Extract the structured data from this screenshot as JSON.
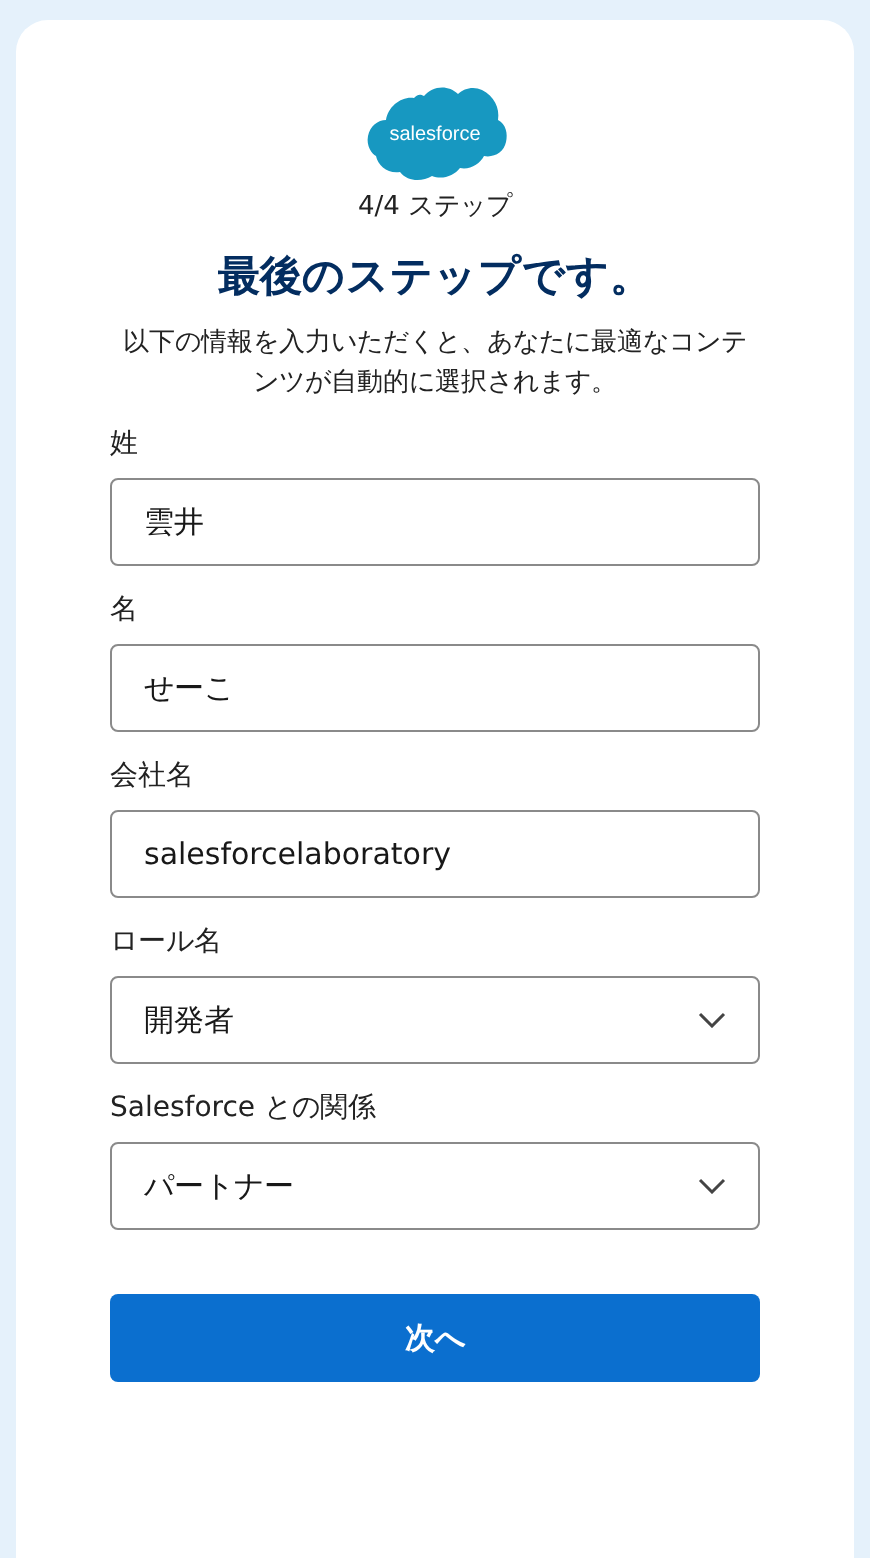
{
  "logo": {
    "text": "salesforce"
  },
  "step": "4/4 ステップ",
  "title": "最後のステップです。",
  "description": "以下の情報を入力いただくと、あなたに最適なコンテンツが自動的に選択されます。",
  "fields": [
    {
      "kind": "text",
      "label": "姓",
      "value": "雲井"
    },
    {
      "kind": "text",
      "label": "名",
      "value": "せーこ"
    },
    {
      "kind": "text",
      "label": "会社名",
      "value": "salesforcelaboratory"
    },
    {
      "kind": "select",
      "label": "ロール名",
      "value": "開発者"
    },
    {
      "kind": "select",
      "label": "Salesforce との関係",
      "value": "パートナー"
    }
  ],
  "submit": "次へ"
}
